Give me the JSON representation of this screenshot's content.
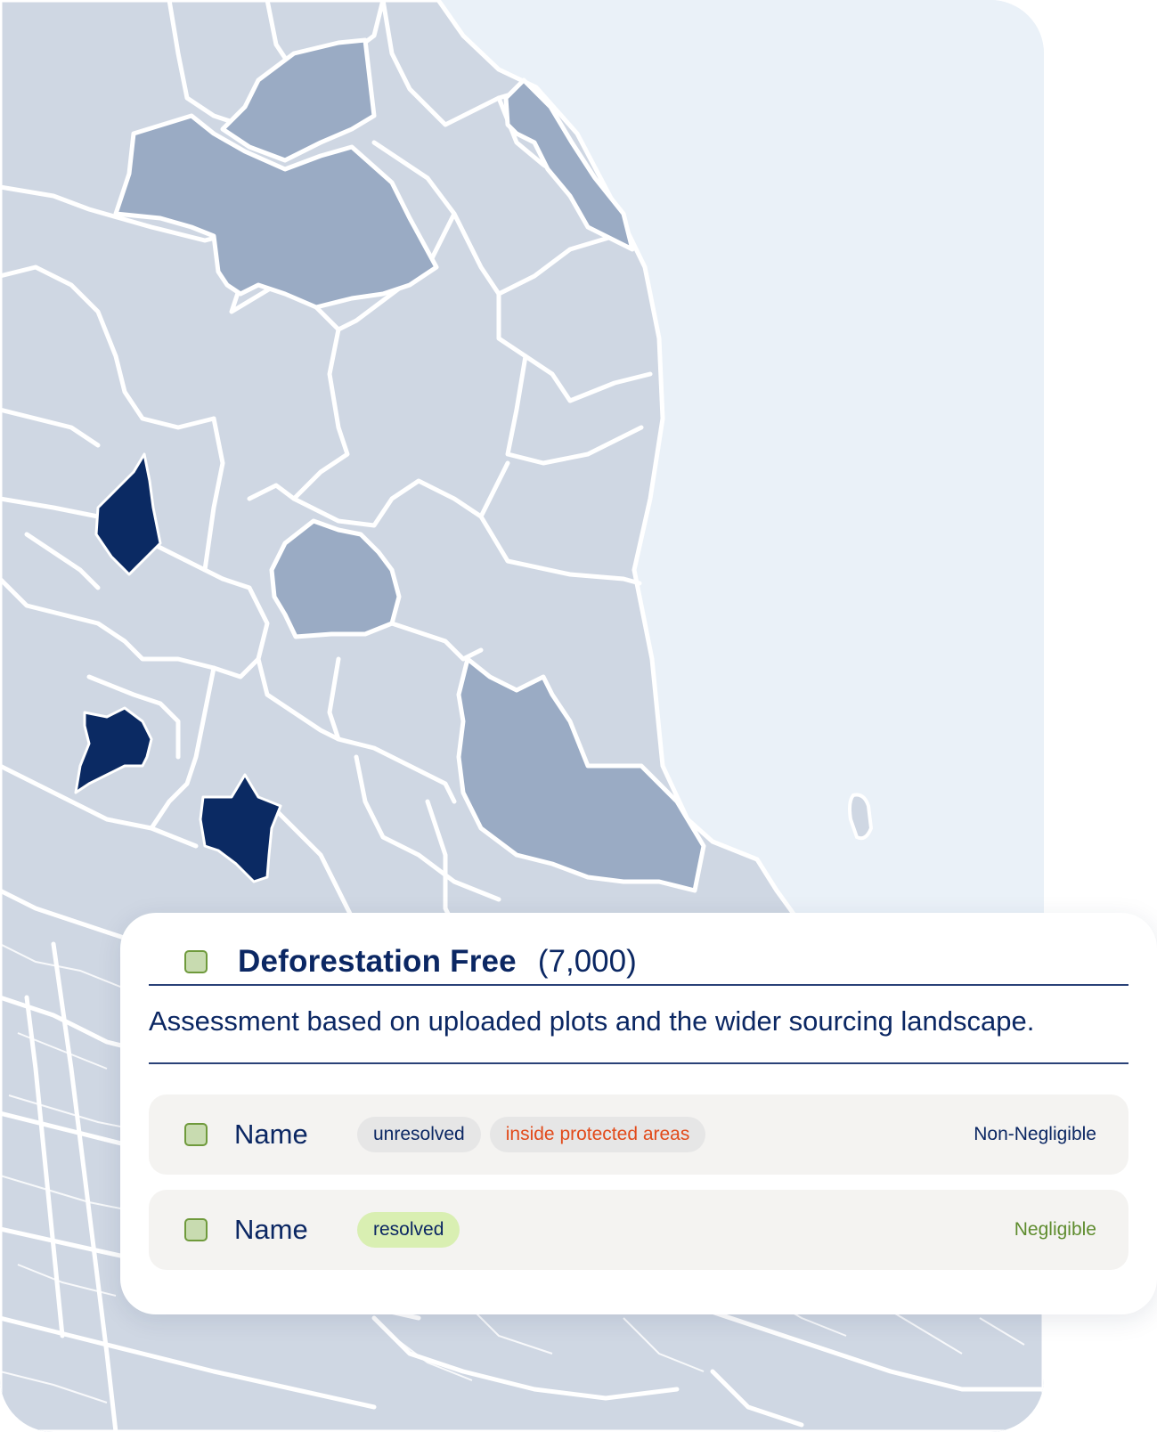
{
  "colors": {
    "sea": "#eaf1f8",
    "land": "#cfd7e3",
    "medium_region": "#9aabc4",
    "high_region": "#0b2a63",
    "borders": "#ffffff",
    "text_primary": "#0b2763",
    "non_negligible": "#0b2763",
    "negligible": "#5e8c2e",
    "alert_tag_text": "#e24a1a",
    "resolved_tag_bg": "#d9efb2"
  },
  "map": {
    "icon": "regional-risk-map"
  },
  "card": {
    "checkbox_icon": "checkbox-icon",
    "title": "Deforestation Free",
    "count": "(7,000)",
    "description": "Assessment based on uploaded plots and the wider sourcing landscape.",
    "rows": [
      {
        "name": "Name",
        "tags": [
          "unresolved",
          "inside protected areas"
        ],
        "risk": "Non-Negligible"
      },
      {
        "name": "Name",
        "tags": [
          "resolved"
        ],
        "risk": "Negligible"
      }
    ]
  }
}
